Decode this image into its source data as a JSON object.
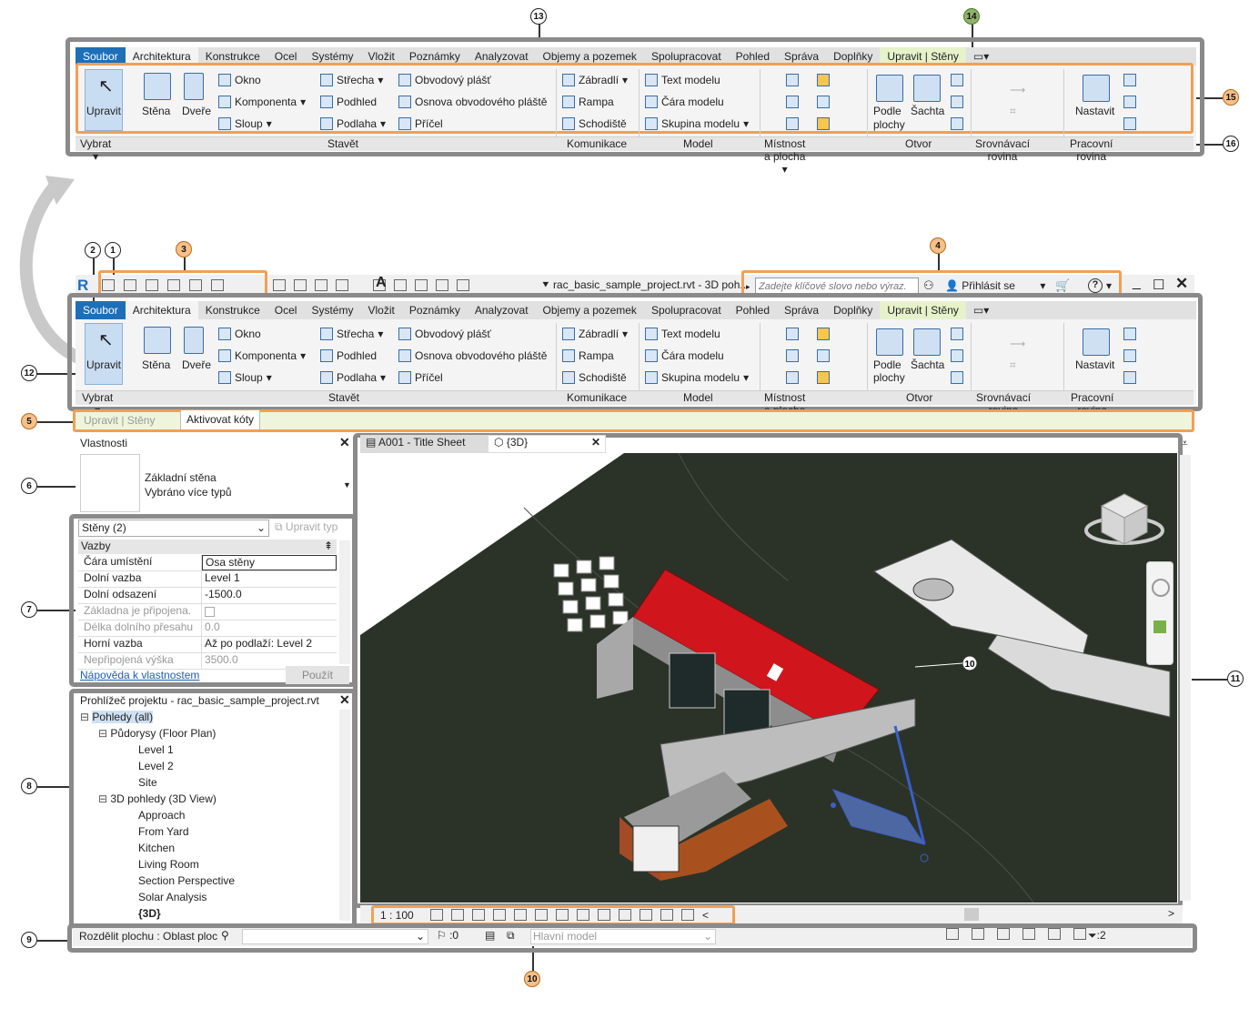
{
  "callouts": {
    "c1": "1",
    "c2": "2",
    "c3": "3",
    "c4": "4",
    "c5": "5",
    "c6": "6",
    "c7": "7",
    "c8": "8",
    "c9": "9",
    "c10": "10",
    "c10b": "10",
    "c11": "11",
    "c12": "12",
    "c13": "13",
    "c14": "14",
    "c15": "15",
    "c16": "16"
  },
  "tabs": [
    "Soubor",
    "Architektura",
    "Konstrukce",
    "Ocel",
    "Systémy",
    "Vložit",
    "Poznámky",
    "Analyzovat",
    "Objemy a pozemek",
    "Spolupracovat",
    "Pohled",
    "Správa",
    "Doplňky",
    "Upravit | Stěny"
  ],
  "ribbon": {
    "modify": "Upravit",
    "select": "Vybrat",
    "wall": "Stěna",
    "door": "Dveře",
    "window": "Okno",
    "component": "Komponenta",
    "column": "Sloup",
    "roof": "Střecha",
    "ceiling": "Podhled",
    "floor": "Podlaha",
    "curtain_system": "Obvodový plášť",
    "curtain_grid": "Osnova obvodového pláště",
    "mullion": "Příčel",
    "build": "Stavět",
    "railing": "Zábradlí",
    "ramp": "Rampa",
    "stair": "Schodiště",
    "circulation": "Komunikace",
    "model_text": "Text modelu",
    "model_line": "Čára  modelu",
    "model_group": "Skupina modelu",
    "model": "Model",
    "room_area": "Místnost a plocha",
    "by_face": "Podle plochy",
    "shaft": "Šachta",
    "opening": "Otvor",
    "datum": "Srovnávací rovina",
    "set": "Nastavit",
    "work_plane": "Pracovní rovina"
  },
  "qat": {
    "title": "rac_basic_sample_project.rvt - 3D poh...",
    "search_placeholder": "Zadejte klíčové slovo nebo výraz.",
    "sign_in": "Přihlásit se",
    "help": "?"
  },
  "options_bar": {
    "context": "Upravit | Stěny",
    "activate_dims": "Aktivovat kóty"
  },
  "properties": {
    "title": "Vlastnosti",
    "type_name": "Základní stěna",
    "type_sub": "Vybráno více typů",
    "filter": "Stěny (2)",
    "edit_type": "Upravit typ",
    "group": "Vazby",
    "rows": [
      {
        "name": "Čára umístění",
        "value": "Osa stěny"
      },
      {
        "name": "Dolní vazba",
        "value": "Level 1"
      },
      {
        "name": "Dolní odsazení",
        "value": "-1500.0"
      },
      {
        "name": "Základna je připojena.",
        "value": ""
      },
      {
        "name": "Délka dolního přesahu",
        "value": "0.0"
      },
      {
        "name": "Horní vazba",
        "value": "Až po podlaží: Level 2"
      },
      {
        "name": "Nepřipojená výška",
        "value": "3500.0"
      }
    ],
    "help_link": "Nápověda k vlastnostem",
    "apply": "Použít"
  },
  "browser": {
    "title": "Prohlížeč projektu - rac_basic_sample_project.rvt",
    "items": [
      {
        "label": "Pohledy (all)",
        "level": 0
      },
      {
        "label": "Půdorysy (Floor Plan)",
        "level": 1
      },
      {
        "label": "Level 1",
        "level": 2
      },
      {
        "label": "Level 2",
        "level": 2
      },
      {
        "label": "Site",
        "level": 2
      },
      {
        "label": "3D pohledy (3D View)",
        "level": 1
      },
      {
        "label": "Approach",
        "level": 2
      },
      {
        "label": "From Yard",
        "level": 2
      },
      {
        "label": "Kitchen",
        "level": 2
      },
      {
        "label": "Living Room",
        "level": 2
      },
      {
        "label": "Section Perspective",
        "level": 2
      },
      {
        "label": "Solar Analysis",
        "level": 2
      },
      {
        "label": "{3D}",
        "level": 2
      }
    ]
  },
  "view_tabs": [
    "A001 - Title Sheet",
    "{3D}"
  ],
  "view_control": {
    "scale": "1 : 100"
  },
  "status": {
    "text": "Rozdělit plochu : Oblast ploc",
    "zero": ":0",
    "model": "Hlavní model",
    "filter_count": ":2"
  },
  "colors": {
    "file_tab": "#1d6fb8",
    "roof": "#d0161c",
    "gray_frame": "#8a8a8a",
    "orange_frame": "#f0a055"
  }
}
